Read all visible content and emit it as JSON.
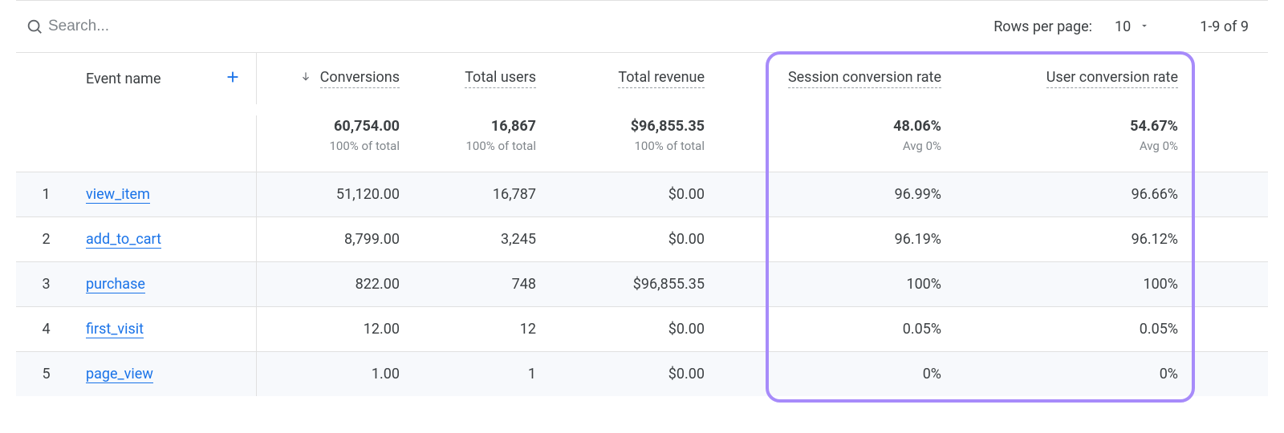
{
  "toolbar": {
    "search_placeholder": "Search...",
    "rows_per_page_label": "Rows per page:",
    "rows_per_page_value": "10",
    "page_range": "1-9 of 9"
  },
  "columns": {
    "event_name": "Event name",
    "conversions": "Conversions",
    "total_users": "Total users",
    "total_revenue": "Total revenue",
    "session_conv_rate": "Session conversion rate",
    "user_conv_rate": "User conversion rate"
  },
  "summary": {
    "conversions": "60,754.00",
    "conversions_sub": "100% of total",
    "total_users": "16,867",
    "total_users_sub": "100% of total",
    "total_revenue": "$96,855.35",
    "total_revenue_sub": "100% of total",
    "session_conv_rate": "48.06%",
    "session_conv_rate_sub": "Avg 0%",
    "user_conv_rate": "54.67%",
    "user_conv_rate_sub": "Avg 0%"
  },
  "rows": [
    {
      "idx": "1",
      "event": "view_item",
      "conversions": "51,120.00",
      "users": "16,787",
      "revenue": "$0.00",
      "session": "96.99%",
      "user": "96.66%"
    },
    {
      "idx": "2",
      "event": "add_to_cart",
      "conversions": "8,799.00",
      "users": "3,245",
      "revenue": "$0.00",
      "session": "96.19%",
      "user": "96.12%"
    },
    {
      "idx": "3",
      "event": "purchase",
      "conversions": "822.00",
      "users": "748",
      "revenue": "$96,855.35",
      "session": "100%",
      "user": "100%"
    },
    {
      "idx": "4",
      "event": "first_visit",
      "conversions": "12.00",
      "users": "12",
      "revenue": "$0.00",
      "session": "0.05%",
      "user": "0.05%"
    },
    {
      "idx": "5",
      "event": "page_view",
      "conversions": "1.00",
      "users": "1",
      "revenue": "$0.00",
      "session": "0%",
      "user": "0%"
    }
  ]
}
